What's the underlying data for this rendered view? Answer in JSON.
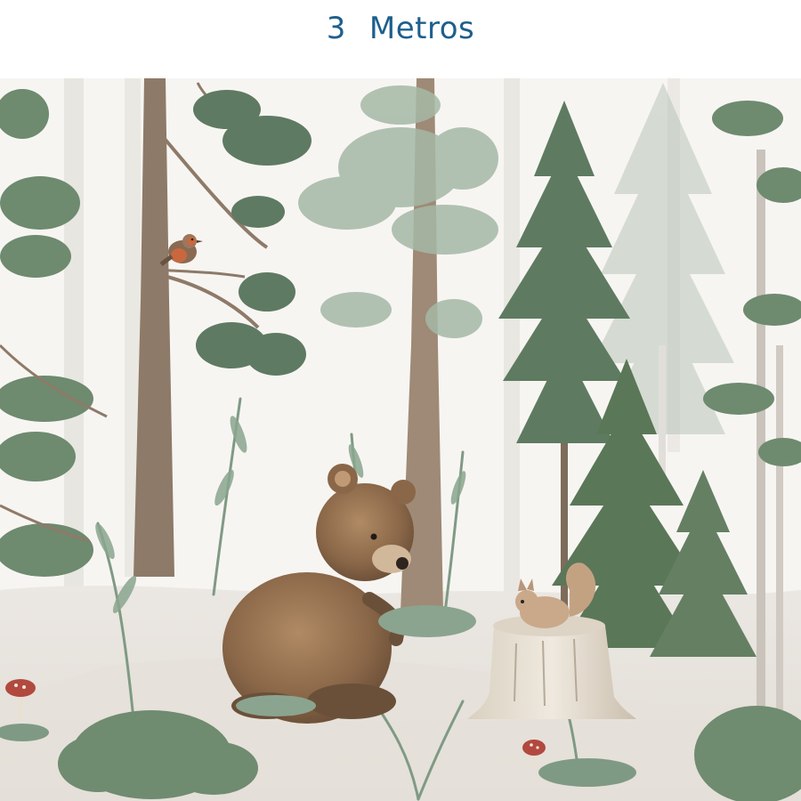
{
  "header": {
    "number": "3",
    "unit": "Metros"
  },
  "colors": {
    "title": "#1e5f8c",
    "background": "#f6f4f1",
    "foliage_dark": "#5f7a62",
    "foliage_light": "#9fb3a2",
    "trunk": "#8e7a68",
    "bear": "#8a6748"
  },
  "scene": {
    "subjects": [
      "bear",
      "squirrel",
      "robin",
      "pine-trees",
      "birch-trees",
      "tree-stump",
      "mushrooms",
      "ferns"
    ]
  }
}
